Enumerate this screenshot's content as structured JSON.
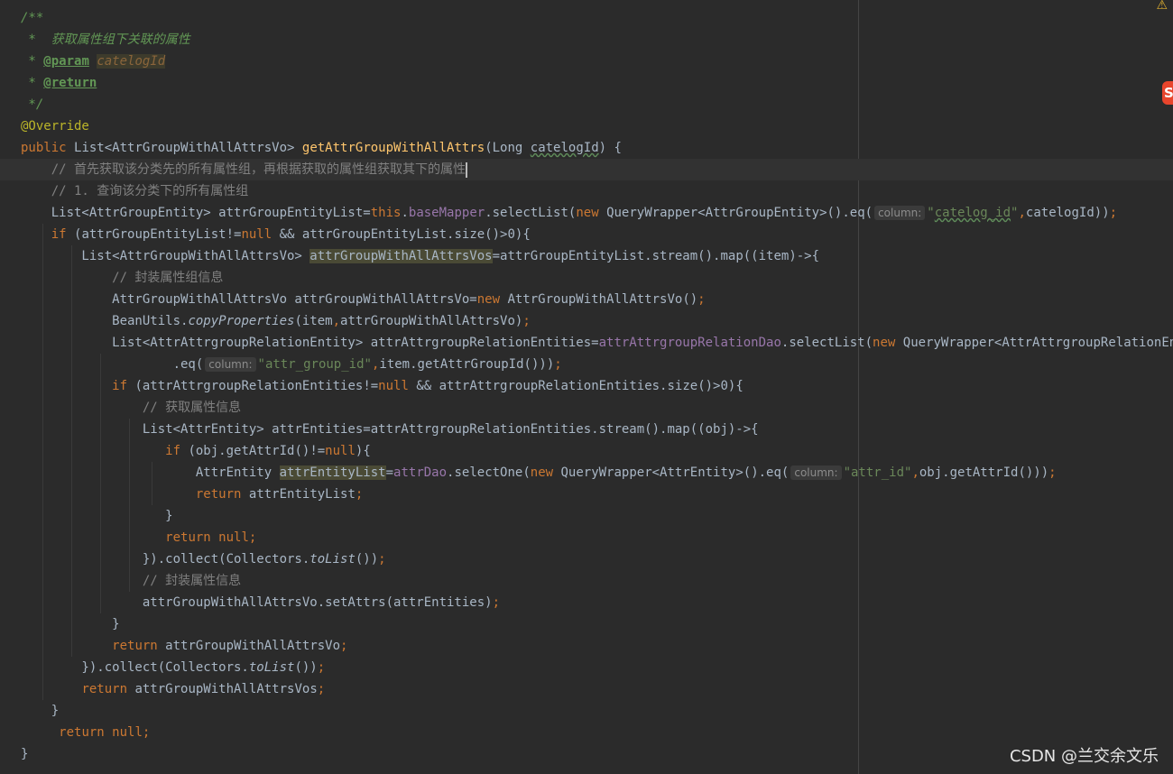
{
  "watermark": "CSDN @兰交余文乐",
  "icons": {
    "warning": "warning-icon",
    "badge": "plugin-badge-icon"
  },
  "badge_glyph": "S",
  "colors": {
    "background": "#2b2b2b",
    "keyword": "#cc7832",
    "string": "#6a8759",
    "comment": "#808080",
    "function": "#ffc66d",
    "field": "#9876aa",
    "annotation": "#bbb529"
  },
  "lines": [
    {
      "tokens": [
        {
          "t": "/**",
          "c": "doc"
        }
      ]
    },
    {
      "tokens": [
        {
          "t": " *  获取属性组下关联的属性",
          "c": "doc"
        }
      ]
    },
    {
      "tokens": [
        {
          "t": " * ",
          "c": "doc"
        },
        {
          "t": "@param",
          "c": "doctag"
        },
        {
          "t": " ",
          "c": "doc"
        },
        {
          "t": "catelogId",
          "c": "docval"
        }
      ]
    },
    {
      "tokens": [
        {
          "t": " * ",
          "c": "doc"
        },
        {
          "t": "@return",
          "c": "doctag"
        }
      ]
    },
    {
      "tokens": [
        {
          "t": " */",
          "c": "doc"
        }
      ]
    },
    {
      "tokens": [
        {
          "t": "@Override",
          "c": "ann"
        }
      ]
    },
    {
      "tokens": [
        {
          "t": "public ",
          "c": "kw"
        },
        {
          "t": "List<AttrGroupWithAllAttrsVo> "
        },
        {
          "t": "getAttrGroupWithAllAttrs",
          "c": "fn"
        },
        {
          "t": "(Long "
        },
        {
          "t": "catelogId",
          "c": "wavy"
        },
        {
          "t": ") {"
        }
      ]
    },
    {
      "tokens": [
        {
          "t": "    // 首先获取该分类先的所有属性组，再根据获取的属性组获取其下的属性",
          "c": "cmt"
        }
      ]
    },
    {
      "tokens": [
        {
          "t": "    // 1. 查询该分类下的所有属性组",
          "c": "cmt"
        }
      ]
    },
    {
      "tokens": [
        {
          "t": "    List<AttrGroupEntity> attrGroupEntityList="
        },
        {
          "t": "this",
          "c": "kw"
        },
        {
          "t": "."
        },
        {
          "t": "baseMapper",
          "c": "field"
        },
        {
          "t": ".selectList("
        },
        {
          "t": "new ",
          "c": "kw"
        },
        {
          "t": "QueryWrapper<AttrGroupEntity>().eq("
        },
        {
          "t": "column:",
          "c": "hint"
        },
        {
          "t": "\"",
          "c": "str"
        },
        {
          "t": "catelog_id",
          "c": "str wavy"
        },
        {
          "t": "\"",
          "c": "str"
        },
        {
          "t": ",",
          "c": "kw"
        },
        {
          "t": "catelogId))"
        },
        {
          "t": ";",
          "c": "kw"
        }
      ]
    },
    {
      "tokens": [
        {
          "t": "    "
        },
        {
          "t": "if ",
          "c": "kw"
        },
        {
          "t": "(attrGroupEntityList!="
        },
        {
          "t": "null ",
          "c": "kw"
        },
        {
          "t": "&& attrGroupEntityList.size()>0){"
        }
      ]
    },
    {
      "tokens": [
        {
          "t": "        List<AttrGroupWithAllAttrsVo> "
        },
        {
          "t": "attrGroupWithAllAttrsVos",
          "c": "hl"
        },
        {
          "t": "=attrGroupEntityList.stream().map((item)->{"
        }
      ]
    },
    {
      "tokens": [
        {
          "t": "            // 封装属性组信息",
          "c": "cmt"
        }
      ]
    },
    {
      "tokens": [
        {
          "t": "            AttrGroupWithAllAttrsVo attrGroupWithAllAttrsVo="
        },
        {
          "t": "new ",
          "c": "kw"
        },
        {
          "t": "AttrGroupWithAllAttrsVo()"
        },
        {
          "t": ";",
          "c": "kw"
        }
      ]
    },
    {
      "tokens": [
        {
          "t": "            BeanUtils."
        },
        {
          "t": "copyProperties",
          "c": "it"
        },
        {
          "t": "(item"
        },
        {
          "t": ",",
          "c": "kw"
        },
        {
          "t": "attrGroupWithAllAttrsVo)"
        },
        {
          "t": ";",
          "c": "kw"
        }
      ]
    },
    {
      "tokens": [
        {
          "t": "            List<AttrAttrgroupRelationEntity> attrAttrgroupRelationEntities="
        },
        {
          "t": "attrAttrgroupRelationDao",
          "c": "field"
        },
        {
          "t": ".selectList("
        },
        {
          "t": "new ",
          "c": "kw"
        },
        {
          "t": "QueryWrapper<AttrAttrgroupRelationEntity>()"
        }
      ]
    },
    {
      "tokens": [
        {
          "t": "                    .eq("
        },
        {
          "t": "column:",
          "c": "hint"
        },
        {
          "t": "\"attr_group_id\"",
          "c": "str"
        },
        {
          "t": ",",
          "c": "kw"
        },
        {
          "t": "item.getAttrGroupId()))"
        },
        {
          "t": ";",
          "c": "kw"
        }
      ]
    },
    {
      "tokens": [
        {
          "t": "            "
        },
        {
          "t": "if ",
          "c": "kw"
        },
        {
          "t": "(attrAttrgroupRelationEntities!="
        },
        {
          "t": "null ",
          "c": "kw"
        },
        {
          "t": "&& attrAttrgroupRelationEntities.size()>0){"
        }
      ]
    },
    {
      "tokens": [
        {
          "t": "                // 获取属性信息",
          "c": "cmt"
        }
      ]
    },
    {
      "tokens": [
        {
          "t": "                List<AttrEntity> attrEntities=attrAttrgroupRelationEntities.stream().map((obj)->{"
        }
      ]
    },
    {
      "tokens": [
        {
          "t": "                   "
        },
        {
          "t": "if ",
          "c": "kw"
        },
        {
          "t": "(obj.getAttrId()!="
        },
        {
          "t": "null",
          "c": "kw"
        },
        {
          "t": "){"
        }
      ]
    },
    {
      "tokens": [
        {
          "t": "                       AttrEntity "
        },
        {
          "t": "attrEntityList",
          "c": "hl"
        },
        {
          "t": "="
        },
        {
          "t": "attrDao",
          "c": "field"
        },
        {
          "t": ".selectOne("
        },
        {
          "t": "new ",
          "c": "kw"
        },
        {
          "t": "QueryWrapper<AttrEntity>().eq("
        },
        {
          "t": "column:",
          "c": "hint"
        },
        {
          "t": "\"attr_id\"",
          "c": "str"
        },
        {
          "t": ",",
          "c": "kw"
        },
        {
          "t": "obj.getAttrId()))"
        },
        {
          "t": ";",
          "c": "kw"
        }
      ]
    },
    {
      "tokens": [
        {
          "t": "                       "
        },
        {
          "t": "return ",
          "c": "kw"
        },
        {
          "t": "attrEntityList"
        },
        {
          "t": ";",
          "c": "kw"
        }
      ]
    },
    {
      "tokens": [
        {
          "t": "                   }"
        }
      ]
    },
    {
      "tokens": [
        {
          "t": "                   "
        },
        {
          "t": "return ",
          "c": "kw"
        },
        {
          "t": "null;",
          "c": "kw"
        }
      ]
    },
    {
      "tokens": [
        {
          "t": "                }).collect(Collectors."
        },
        {
          "t": "toList",
          "c": "it"
        },
        {
          "t": "())"
        },
        {
          "t": ";",
          "c": "kw"
        }
      ]
    },
    {
      "tokens": [
        {
          "t": "                // 封装属性信息",
          "c": "cmt"
        }
      ]
    },
    {
      "tokens": [
        {
          "t": "                attrGroupWithAllAttrsVo.setAttrs(attrEntities)"
        },
        {
          "t": ";",
          "c": "kw"
        }
      ]
    },
    {
      "tokens": [
        {
          "t": "            }"
        }
      ]
    },
    {
      "tokens": [
        {
          "t": "            "
        },
        {
          "t": "return ",
          "c": "kw"
        },
        {
          "t": "attrGroupWithAllAttrsVo"
        },
        {
          "t": ";",
          "c": "kw"
        }
      ]
    },
    {
      "tokens": [
        {
          "t": "        }).collect(Collectors."
        },
        {
          "t": "toList",
          "c": "it"
        },
        {
          "t": "())"
        },
        {
          "t": ";",
          "c": "kw"
        }
      ]
    },
    {
      "tokens": [
        {
          "t": "        "
        },
        {
          "t": "return ",
          "c": "kw"
        },
        {
          "t": "attrGroupWithAllAttrsVos"
        },
        {
          "t": ";",
          "c": "kw"
        }
      ]
    },
    {
      "tokens": [
        {
          "t": "    }"
        }
      ]
    },
    {
      "tokens": [
        {
          "t": "     "
        },
        {
          "t": "return ",
          "c": "kw"
        },
        {
          "t": "null;",
          "c": "kw"
        }
      ]
    },
    {
      "tokens": [
        {
          "t": "}"
        }
      ]
    }
  ]
}
